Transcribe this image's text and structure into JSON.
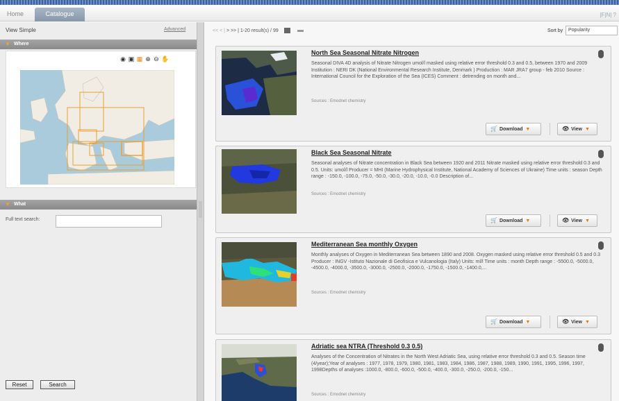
{
  "nav": {
    "home": "Home",
    "catalogue": "Catalogue",
    "top_icons": "|F|N| ?"
  },
  "left": {
    "view_simple": "View Simple",
    "advanced": "Advanced",
    "where": "Where",
    "what": "What",
    "full_text_label": "Full text search:",
    "full_text_value": "",
    "reset": "Reset",
    "search": "Search",
    "map_tools": [
      "globe-icon",
      "layers-icon",
      "draw-box-icon",
      "zoom-in-icon",
      "zoom-out-icon",
      "pan-hand-icon"
    ]
  },
  "results": {
    "pager_prev": "<< < |",
    "pager_next": "> >> |",
    "pager_info": "1-20 result(s) / 99",
    "sort_label": "Sort by",
    "sort_value": "Popularity",
    "download_label": "Download",
    "view_label": "View",
    "items": [
      {
        "title": "North Sea Seasonal Nitrate Nitrogen",
        "description": "Seasonal DIVA 4D analysis of Nitrate Nitrogen umol/l masked using relative error threshold 0.3 and 0.5, between 1970 and 2009 Institution : NERI DK (National Environmental Research Institute, Denmark ) Production : MAR JRA7 group - feb 2010 Source : International Council for the Exploration of the Sea (ICES) Comment : detrending on month and...",
        "source": "Sources : Emodnet chemistry"
      },
      {
        "title": "Black Sea Seasonal Nitrate",
        "description": "Seasonal analyses of Nitrate concentration in Black Sea between 1920 and 2011 Nitrate masked using relative error threshold 0.3 and 0.5. Units: umol/l Producer = MHI (Marine Hydrophysical Institute, National Academy of Sciences of Ukraine) Time units : season Depth range : -150.0, -100.0, -75.0, -50.0, -30.0, -20.0, -10.0, -0.0 Description of...",
        "source": "Sources : Emodnet chemistry"
      },
      {
        "title": "Mediterranean Sea monthly Oxygen",
        "description": "Monthly analyses of Oxygen in Mediterranean Sea between 1890 and 2008. Oxygen masked using relative error threshold 0.5 and 0.3 Producer : INGV -Istituto Nazionale di Geofisica e Vulcanologia (Italy) Units: ml/l Time units : month Depth range : -5500.0, -5000.0, -4500.0, -4000.0, -3500.0, -3000.0, -2500.0, -2000.0, -1750.0, -1500.0, -1400.0,...",
        "source": "Sources : Emodnet chemistry"
      },
      {
        "title": "Adriatic sea NTRA (Threshold 0.3 0.5)",
        "description": "Analyses of the Concentration of Nitrates in the North West Adriatic Sea, using relative error threshold 0.3 and 0.5. Season time (4/year);Year of analyses : 1977, 1978, 1979, 1980, 1981, 1983, 1984, 1986, 1987, 1988, 1989, 1990, 1991, 1995, 1996, 1997, 1998Depths of analyses :1000.0, -800.0, -600.0, -500.0, -400.0, -300.0, -250.0, -200.0, -150...",
        "source": "Sources : Emodnet chemistry"
      }
    ]
  }
}
